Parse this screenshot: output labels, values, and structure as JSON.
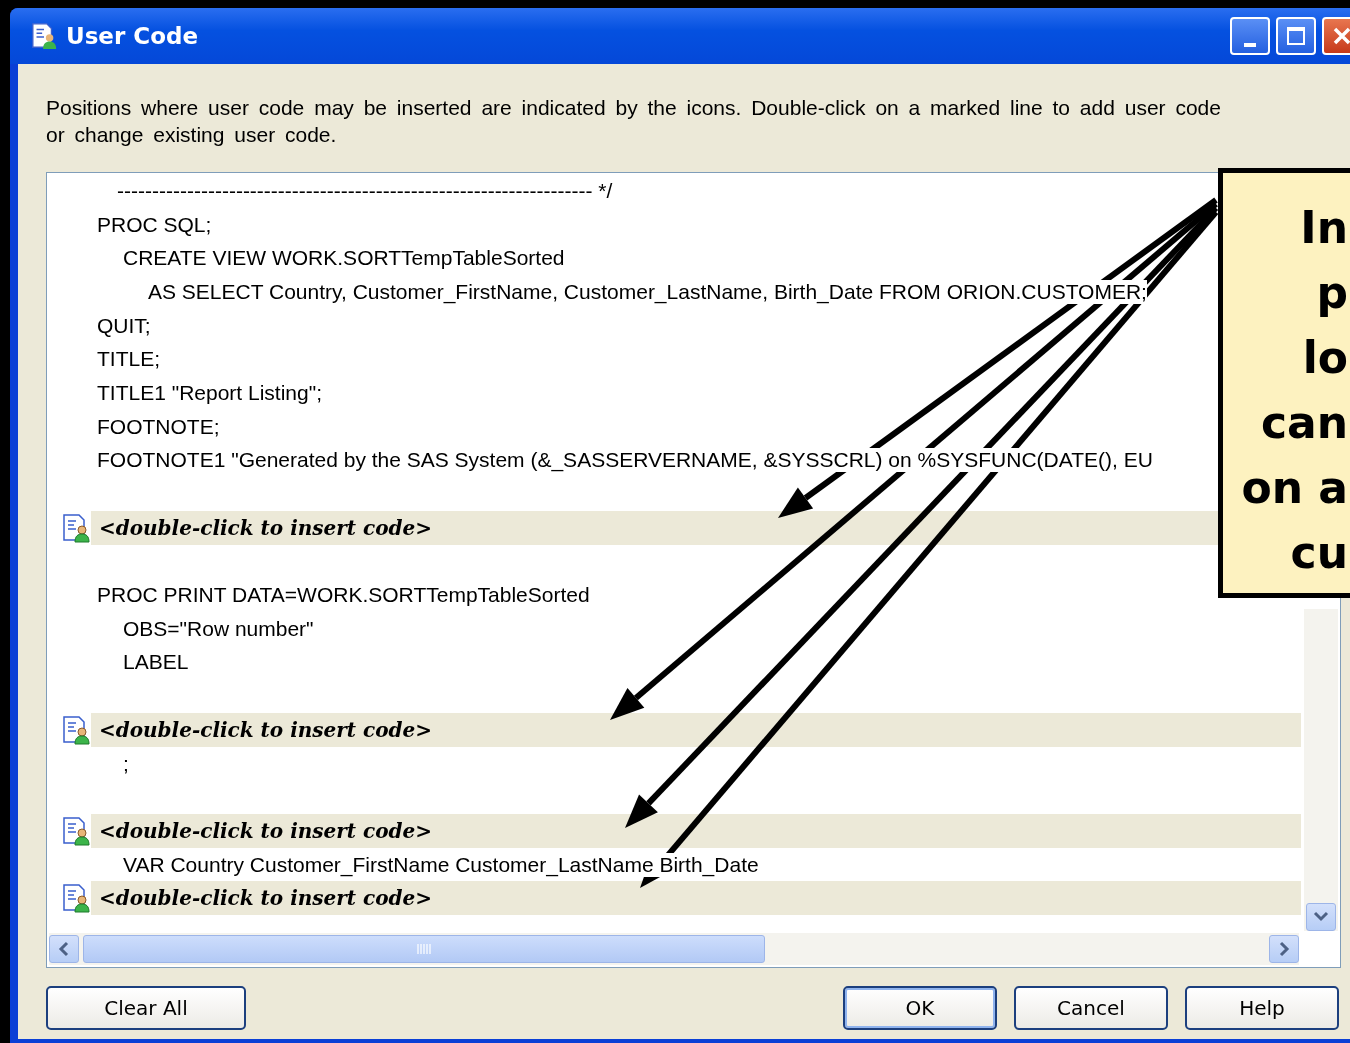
{
  "window": {
    "title": "User Code"
  },
  "description": "Positions where user code may be inserted are indicated by the icons. Double-click on a marked line to add user code or change existing user code.",
  "code_lines": [
    {
      "kind": "comment",
      "text": "-------------------------------------------------------------------- */"
    },
    {
      "kind": "level0",
      "text": "PROC SQL;"
    },
    {
      "kind": "level1",
      "text": "CREATE VIEW WORK.SORTTempTableSorted"
    },
    {
      "kind": "level2",
      "text": "AS SELECT Country, Customer_FirstName, Customer_LastName, Birth_Date FROM ORION.CUSTOMER;"
    },
    {
      "kind": "level0",
      "text": "QUIT;"
    },
    {
      "kind": "level0",
      "text": "TITLE;"
    },
    {
      "kind": "level0",
      "text": "TITLE1 \"Report Listing\";"
    },
    {
      "kind": "level0",
      "text": "FOOTNOTE;"
    },
    {
      "kind": "level0",
      "text": "FOOTNOTE1 \"Generated by the SAS System (&_SASSERVERNAME, &SYSSCRL) on %SYSFUNC(DATE(), EU"
    },
    {
      "kind": "gap"
    },
    {
      "kind": "marker",
      "text": "<double-click to insert code>"
    },
    {
      "kind": "gap"
    },
    {
      "kind": "level0",
      "text": "PROC PRINT DATA=WORK.SORTTempTableSorted"
    },
    {
      "kind": "level1",
      "text": "OBS=\"Row number\""
    },
    {
      "kind": "level1",
      "text": "LABEL"
    },
    {
      "kind": "gap"
    },
    {
      "kind": "marker",
      "text": "<double-click to insert code>"
    },
    {
      "kind": "level1",
      "text": ";"
    },
    {
      "kind": "gap"
    },
    {
      "kind": "marker",
      "text": "<double-click to insert code>"
    },
    {
      "kind": "level1",
      "text": "VAR Country Customer_FirstName Customer_LastName Birth_Date"
    },
    {
      "kind": "marker",
      "text": "<double-click to insert code>"
    }
  ],
  "buttons": [
    {
      "label": "Clear All",
      "default": false
    },
    {
      "label": "OK",
      "default": true
    },
    {
      "label": "Cancel",
      "default": false
    },
    {
      "label": "Help",
      "default": false
    }
  ],
  "callout": {
    "lines": [
      "In",
      "p",
      "lo",
      "can",
      "on a",
      "cu"
    ]
  }
}
